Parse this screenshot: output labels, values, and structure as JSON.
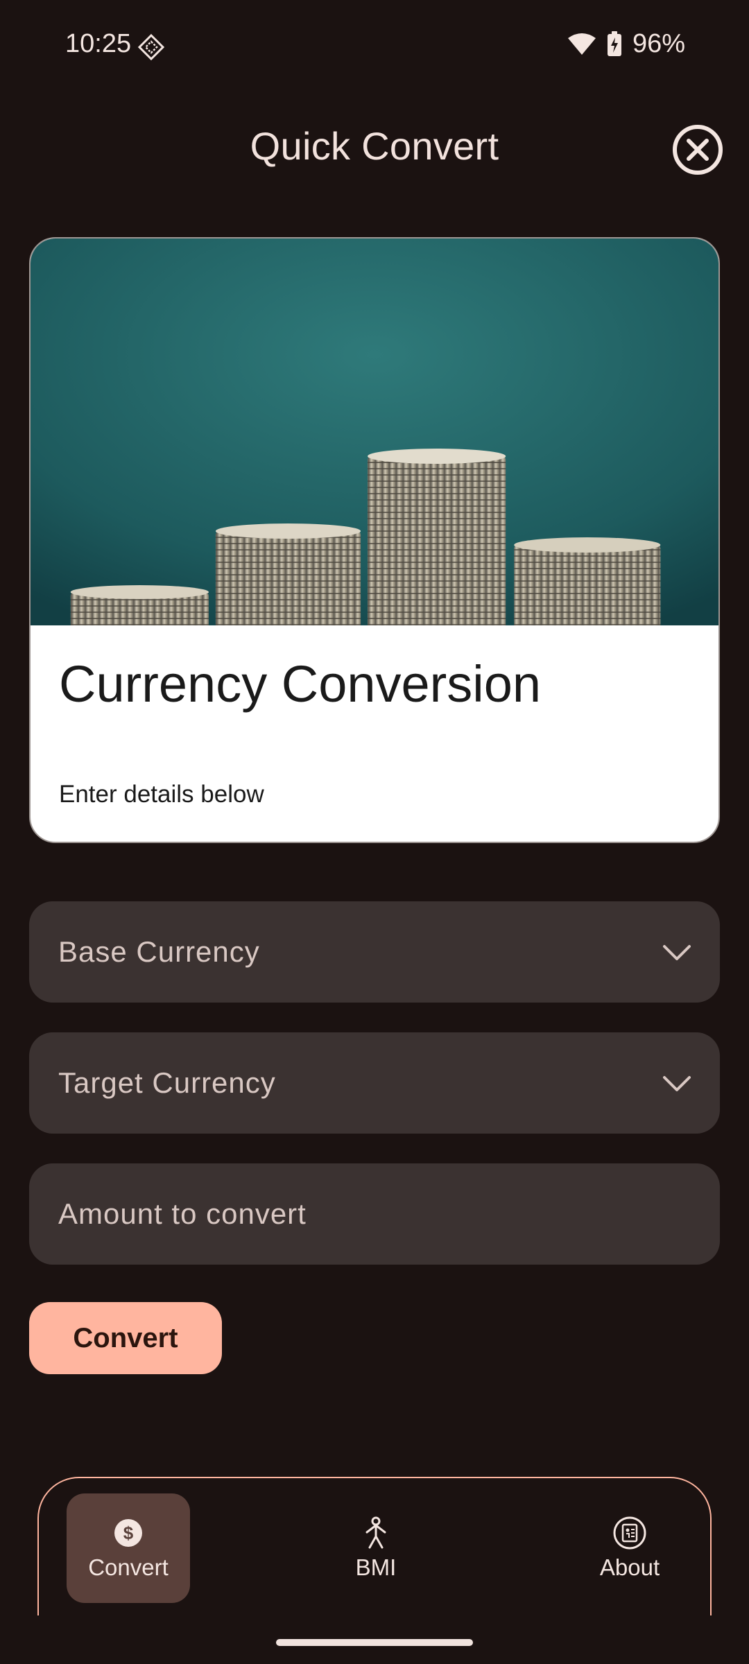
{
  "status_bar": {
    "time": "10:25",
    "battery": "96%"
  },
  "header": {
    "title": "Quick Convert"
  },
  "card": {
    "title": "Currency Conversion",
    "subtitle": "Enter details below"
  },
  "form": {
    "base_currency_label": "Base Currency",
    "target_currency_label": "Target Currency",
    "amount_placeholder": "Amount to convert",
    "convert_button": "Convert"
  },
  "bottom_nav": {
    "items": [
      {
        "label": "Convert",
        "icon": "dollar-icon",
        "active": true
      },
      {
        "label": "BMI",
        "icon": "person-icon",
        "active": false
      },
      {
        "label": "About",
        "icon": "info-book-icon",
        "active": false
      }
    ]
  },
  "colors": {
    "background": "#1b1211",
    "field": "#3b3231",
    "accent": "#ffb59f",
    "nav_active": "#5a403a"
  }
}
